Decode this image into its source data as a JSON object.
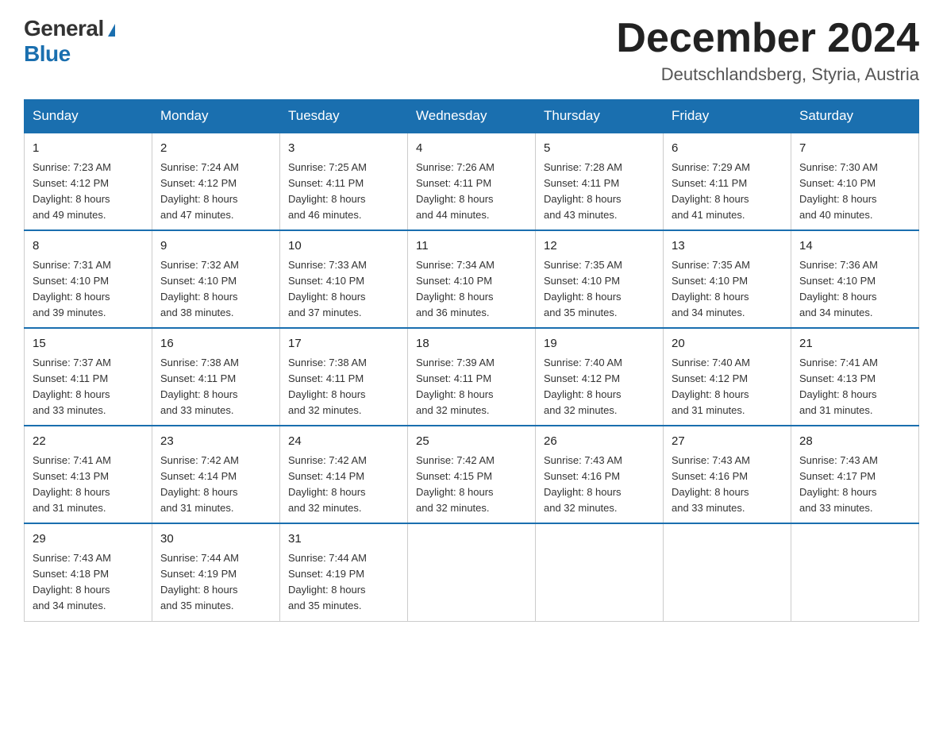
{
  "logo": {
    "general": "General",
    "blue": "Blue"
  },
  "title": "December 2024",
  "location": "Deutschlandsberg, Styria, Austria",
  "weekdays": [
    "Sunday",
    "Monday",
    "Tuesday",
    "Wednesday",
    "Thursday",
    "Friday",
    "Saturday"
  ],
  "weeks": [
    [
      {
        "day": "1",
        "sunrise": "7:23 AM",
        "sunset": "4:12 PM",
        "daylight": "8 hours and 49 minutes."
      },
      {
        "day": "2",
        "sunrise": "7:24 AM",
        "sunset": "4:12 PM",
        "daylight": "8 hours and 47 minutes."
      },
      {
        "day": "3",
        "sunrise": "7:25 AM",
        "sunset": "4:11 PM",
        "daylight": "8 hours and 46 minutes."
      },
      {
        "day": "4",
        "sunrise": "7:26 AM",
        "sunset": "4:11 PM",
        "daylight": "8 hours and 44 minutes."
      },
      {
        "day": "5",
        "sunrise": "7:28 AM",
        "sunset": "4:11 PM",
        "daylight": "8 hours and 43 minutes."
      },
      {
        "day": "6",
        "sunrise": "7:29 AM",
        "sunset": "4:11 PM",
        "daylight": "8 hours and 41 minutes."
      },
      {
        "day": "7",
        "sunrise": "7:30 AM",
        "sunset": "4:10 PM",
        "daylight": "8 hours and 40 minutes."
      }
    ],
    [
      {
        "day": "8",
        "sunrise": "7:31 AM",
        "sunset": "4:10 PM",
        "daylight": "8 hours and 39 minutes."
      },
      {
        "day": "9",
        "sunrise": "7:32 AM",
        "sunset": "4:10 PM",
        "daylight": "8 hours and 38 minutes."
      },
      {
        "day": "10",
        "sunrise": "7:33 AM",
        "sunset": "4:10 PM",
        "daylight": "8 hours and 37 minutes."
      },
      {
        "day": "11",
        "sunrise": "7:34 AM",
        "sunset": "4:10 PM",
        "daylight": "8 hours and 36 minutes."
      },
      {
        "day": "12",
        "sunrise": "7:35 AM",
        "sunset": "4:10 PM",
        "daylight": "8 hours and 35 minutes."
      },
      {
        "day": "13",
        "sunrise": "7:35 AM",
        "sunset": "4:10 PM",
        "daylight": "8 hours and 34 minutes."
      },
      {
        "day": "14",
        "sunrise": "7:36 AM",
        "sunset": "4:10 PM",
        "daylight": "8 hours and 34 minutes."
      }
    ],
    [
      {
        "day": "15",
        "sunrise": "7:37 AM",
        "sunset": "4:11 PM",
        "daylight": "8 hours and 33 minutes."
      },
      {
        "day": "16",
        "sunrise": "7:38 AM",
        "sunset": "4:11 PM",
        "daylight": "8 hours and 33 minutes."
      },
      {
        "day": "17",
        "sunrise": "7:38 AM",
        "sunset": "4:11 PM",
        "daylight": "8 hours and 32 minutes."
      },
      {
        "day": "18",
        "sunrise": "7:39 AM",
        "sunset": "4:11 PM",
        "daylight": "8 hours and 32 minutes."
      },
      {
        "day": "19",
        "sunrise": "7:40 AM",
        "sunset": "4:12 PM",
        "daylight": "8 hours and 32 minutes."
      },
      {
        "day": "20",
        "sunrise": "7:40 AM",
        "sunset": "4:12 PM",
        "daylight": "8 hours and 31 minutes."
      },
      {
        "day": "21",
        "sunrise": "7:41 AM",
        "sunset": "4:13 PM",
        "daylight": "8 hours and 31 minutes."
      }
    ],
    [
      {
        "day": "22",
        "sunrise": "7:41 AM",
        "sunset": "4:13 PM",
        "daylight": "8 hours and 31 minutes."
      },
      {
        "day": "23",
        "sunrise": "7:42 AM",
        "sunset": "4:14 PM",
        "daylight": "8 hours and 31 minutes."
      },
      {
        "day": "24",
        "sunrise": "7:42 AM",
        "sunset": "4:14 PM",
        "daylight": "8 hours and 32 minutes."
      },
      {
        "day": "25",
        "sunrise": "7:42 AM",
        "sunset": "4:15 PM",
        "daylight": "8 hours and 32 minutes."
      },
      {
        "day": "26",
        "sunrise": "7:43 AM",
        "sunset": "4:16 PM",
        "daylight": "8 hours and 32 minutes."
      },
      {
        "day": "27",
        "sunrise": "7:43 AM",
        "sunset": "4:16 PM",
        "daylight": "8 hours and 33 minutes."
      },
      {
        "day": "28",
        "sunrise": "7:43 AM",
        "sunset": "4:17 PM",
        "daylight": "8 hours and 33 minutes."
      }
    ],
    [
      {
        "day": "29",
        "sunrise": "7:43 AM",
        "sunset": "4:18 PM",
        "daylight": "8 hours and 34 minutes."
      },
      {
        "day": "30",
        "sunrise": "7:44 AM",
        "sunset": "4:19 PM",
        "daylight": "8 hours and 35 minutes."
      },
      {
        "day": "31",
        "sunrise": "7:44 AM",
        "sunset": "4:19 PM",
        "daylight": "8 hours and 35 minutes."
      },
      null,
      null,
      null,
      null
    ]
  ],
  "labels": {
    "sunrise": "Sunrise:",
    "sunset": "Sunset:",
    "daylight": "Daylight:"
  }
}
